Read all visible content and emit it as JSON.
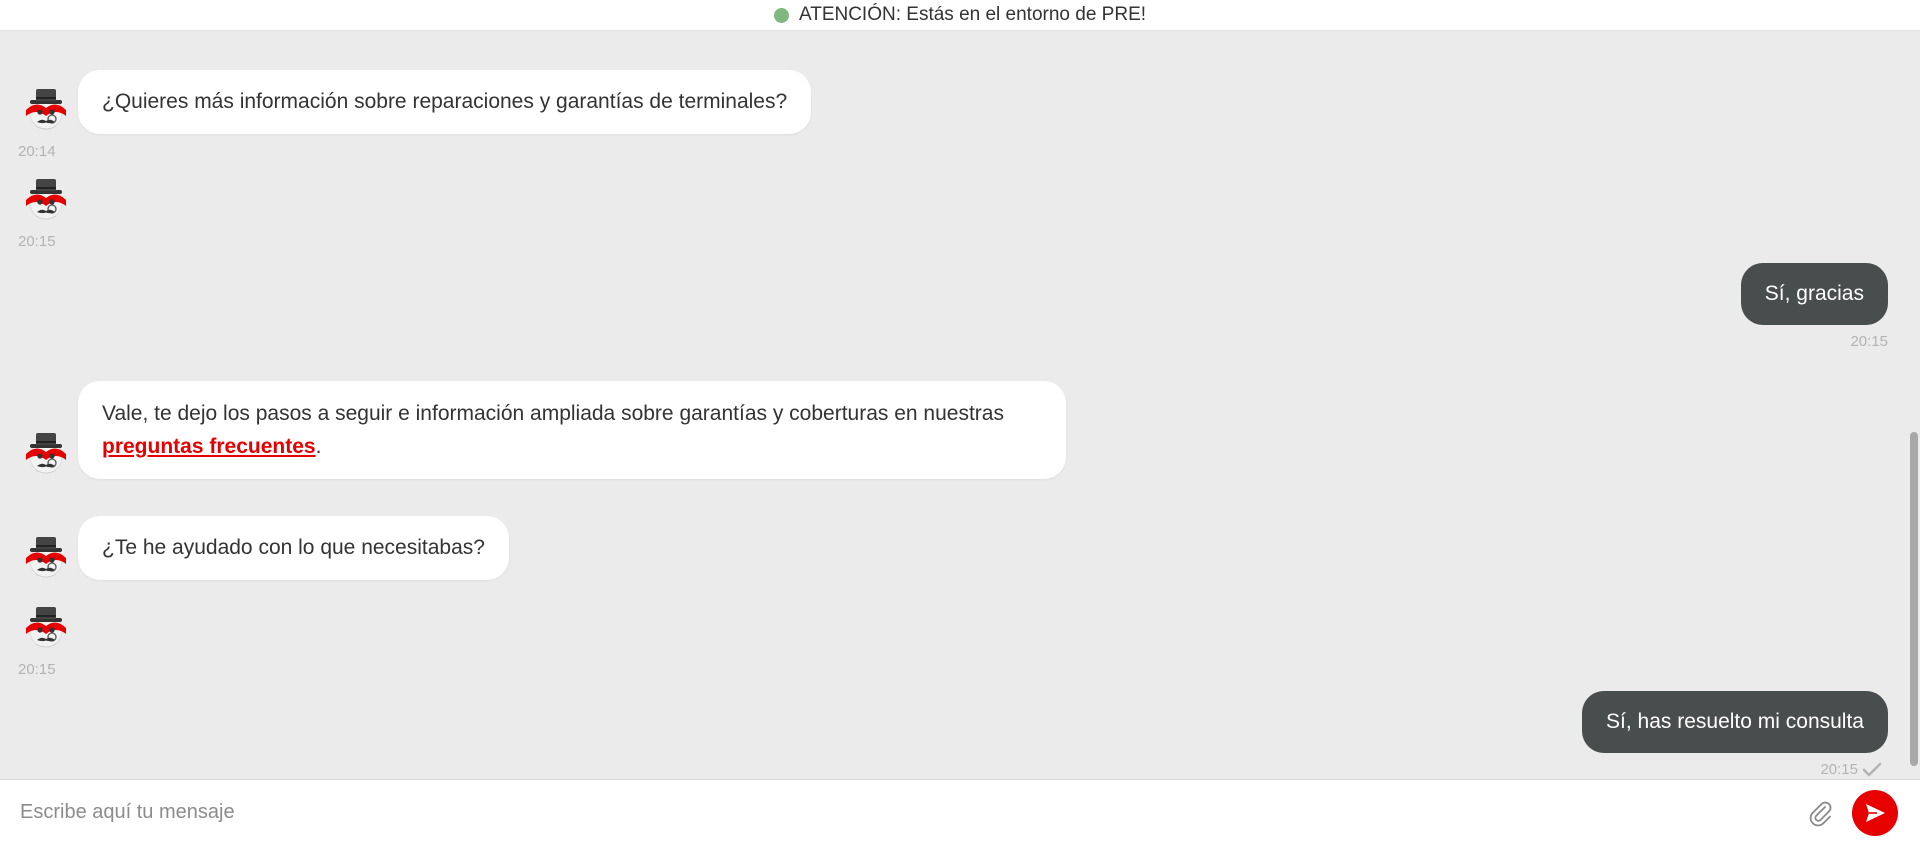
{
  "banner": {
    "text": "ATENCIÓN: Estás en el entorno de PRE!",
    "status_color": "#7fb77e"
  },
  "messages": [
    {
      "sender": "bot",
      "text": "¿Quieres más información sobre reparaciones y garantías de terminales?",
      "time": "20:14"
    },
    {
      "sender": "bot",
      "text": "",
      "time": "20:15"
    },
    {
      "sender": "user",
      "text": "Sí, gracias",
      "time": "20:15"
    },
    {
      "sender": "bot",
      "text": "Vale, te dejo los pasos a seguir e información ampliada sobre garantías y coberturas en nuestras",
      "link_text": "preguntas frecuentes",
      "suffix": "."
    },
    {
      "sender": "bot",
      "text": "¿Te he ayudado con lo que necesitabas?"
    },
    {
      "sender": "bot",
      "text": "",
      "time": "20:15"
    },
    {
      "sender": "user",
      "text": "Sí, has resuelto mi consulta",
      "time": "20:15",
      "status_icon": "check-icon"
    }
  ],
  "input": {
    "placeholder": "Escribe aquí tu mensaje",
    "value": ""
  },
  "icons": {
    "avatar": "bot-avatar-icon",
    "attach": "paperclip-icon",
    "send": "send-icon"
  },
  "colors": {
    "accent": "#e60000",
    "user_bubble": "#4a4d4e",
    "bot_bubble": "#ffffff",
    "background": "#ebebeb"
  }
}
